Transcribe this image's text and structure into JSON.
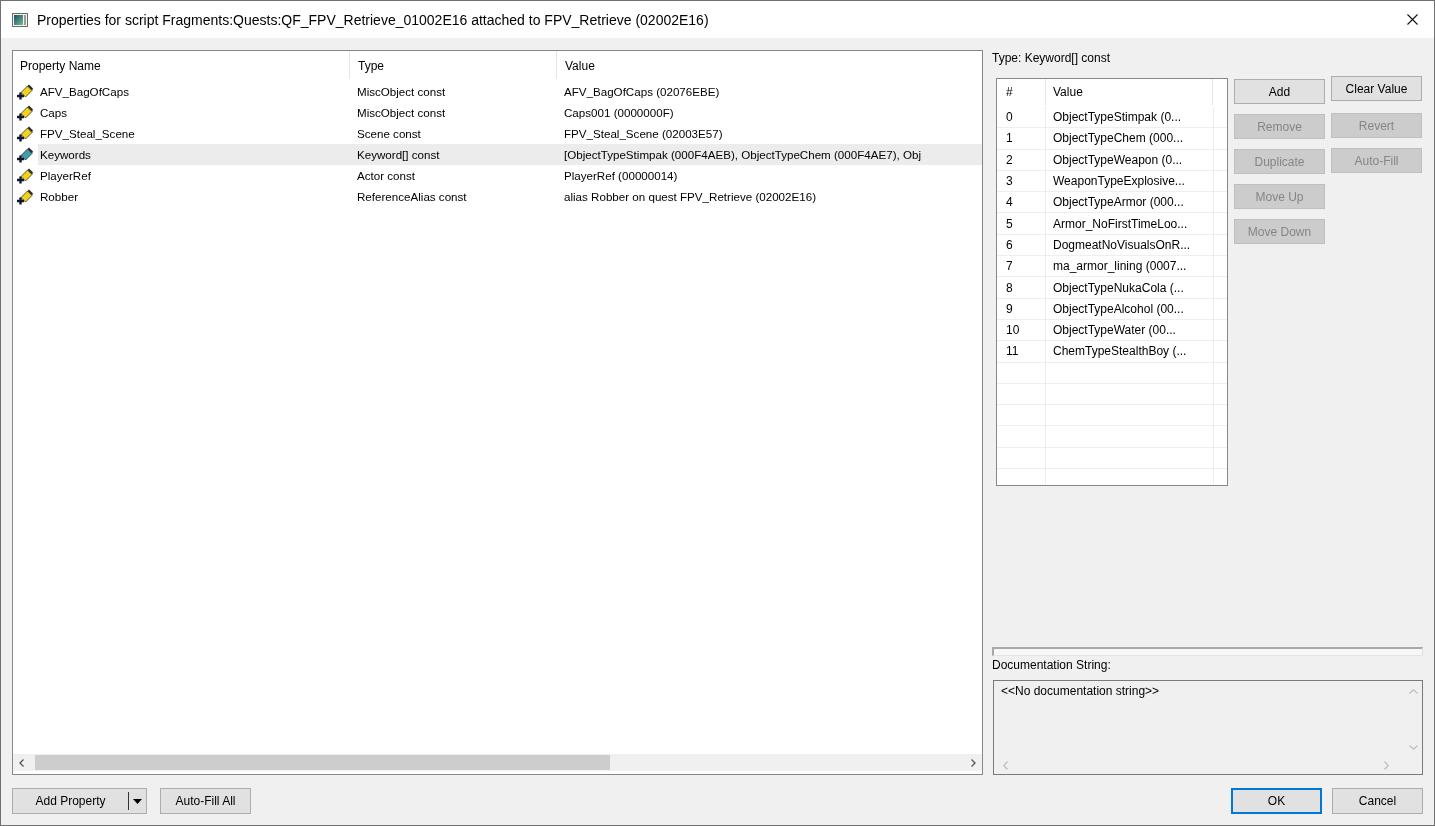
{
  "window": {
    "title": "Properties for script Fragments:Quests:QF_FPV_Retrieve_01002E16 attached to FPV_Retrieve (02002E16)"
  },
  "properties": {
    "columns": [
      "Property Name",
      "Type",
      "Value"
    ],
    "rows": [
      {
        "name": "AFV_BagOfCaps",
        "type": "MiscObject const",
        "value": "AFV_BagOfCaps (02076EBE)",
        "color": "#f2d21c",
        "selected": false
      },
      {
        "name": "Caps",
        "type": "MiscObject const",
        "value": "Caps001 (0000000F)",
        "color": "#f2d21c",
        "selected": false
      },
      {
        "name": "FPV_Steal_Scene",
        "type": "Scene const",
        "value": "FPV_Steal_Scene (02003E57)",
        "color": "#f2d21c",
        "selected": false
      },
      {
        "name": "Keywords",
        "type": "Keyword[] const",
        "value": "[ObjectTypeStimpak (000F4AEB), ObjectTypeChem (000F4AE7), Obj",
        "color": "#3f9fb0",
        "selected": true
      },
      {
        "name": "PlayerRef",
        "type": "Actor const",
        "value": "PlayerRef (00000014)",
        "color": "#f2d21c",
        "selected": false
      },
      {
        "name": "Robber",
        "type": "ReferenceAlias const",
        "value": "alias Robber on quest FPV_Retrieve (02002E16)",
        "color": "#f2d21c",
        "selected": false
      }
    ]
  },
  "detail": {
    "type_label": "Type: Keyword[] const",
    "columns": [
      "#",
      "Value"
    ],
    "items": [
      {
        "index": "0",
        "value": "ObjectTypeStimpak (0..."
      },
      {
        "index": "1",
        "value": "ObjectTypeChem (000..."
      },
      {
        "index": "2",
        "value": "ObjectTypeWeapon (0..."
      },
      {
        "index": "3",
        "value": "WeaponTypeExplosive..."
      },
      {
        "index": "4",
        "value": "ObjectTypeArmor (000..."
      },
      {
        "index": "5",
        "value": "Armor_NoFirstTimeLoo..."
      },
      {
        "index": "6",
        "value": "DogmeatNoVisualsOnR..."
      },
      {
        "index": "7",
        "value": "ma_armor_lining (0007..."
      },
      {
        "index": "8",
        "value": "ObjectTypeNukaCola (..."
      },
      {
        "index": "9",
        "value": "ObjectTypeAlcohol (00..."
      },
      {
        "index": "10",
        "value": "ObjectTypeWater (00..."
      },
      {
        "index": "11",
        "value": "ChemTypeStealthBoy (..."
      }
    ],
    "item_buttons": [
      {
        "label": "Add",
        "disabled": false
      },
      {
        "label": "Remove",
        "disabled": true
      },
      {
        "label": "Duplicate",
        "disabled": true
      },
      {
        "label": "Move Up",
        "disabled": true
      },
      {
        "label": "Move Down",
        "disabled": true
      }
    ],
    "value_buttons": [
      {
        "label": "Clear Value",
        "disabled": false
      },
      {
        "label": "Revert",
        "disabled": true
      },
      {
        "label": "Auto-Fill",
        "disabled": true
      }
    ],
    "documentation": {
      "label": "Documentation String:",
      "text": "<<No documentation string>>",
      "read_only": true
    }
  },
  "footer": {
    "left_buttons": [
      {
        "label": "Add Property",
        "kind": "split"
      },
      {
        "label": "Auto-Fill All",
        "kind": "plain"
      }
    ],
    "right_buttons": [
      {
        "label": "OK",
        "default": true
      },
      {
        "label": "Cancel",
        "default": false
      }
    ]
  }
}
